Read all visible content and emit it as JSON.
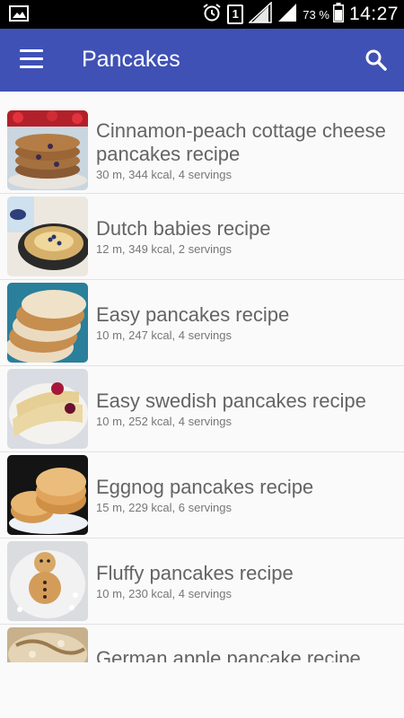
{
  "status_bar": {
    "battery_percent": "73 %",
    "time": "14:27",
    "sim_number": "1"
  },
  "app_bar": {
    "title": "Pancakes"
  },
  "recipes": [
    {
      "title": "Cinnamon-peach cottage cheese pancakes recipe",
      "meta": "30 m, 344 kcal, 4 servings"
    },
    {
      "title": "Dutch babies recipe",
      "meta": "12 m, 349 kcal, 2 servings"
    },
    {
      "title": "Easy pancakes recipe",
      "meta": "10 m, 247 kcal, 4 servings"
    },
    {
      "title": "Easy swedish pancakes recipe",
      "meta": "10 m, 252 kcal, 4 servings"
    },
    {
      "title": "Eggnog pancakes recipe",
      "meta": "15 m, 229 kcal, 6 servings"
    },
    {
      "title": "Fluffy pancakes recipe",
      "meta": "10 m, 230 kcal, 4 servings"
    },
    {
      "title": "German apple pancake recipe",
      "meta": ""
    }
  ],
  "colors": {
    "app_bar": "#3f51b5",
    "status_bar": "#000000",
    "title_text": "#646464"
  }
}
